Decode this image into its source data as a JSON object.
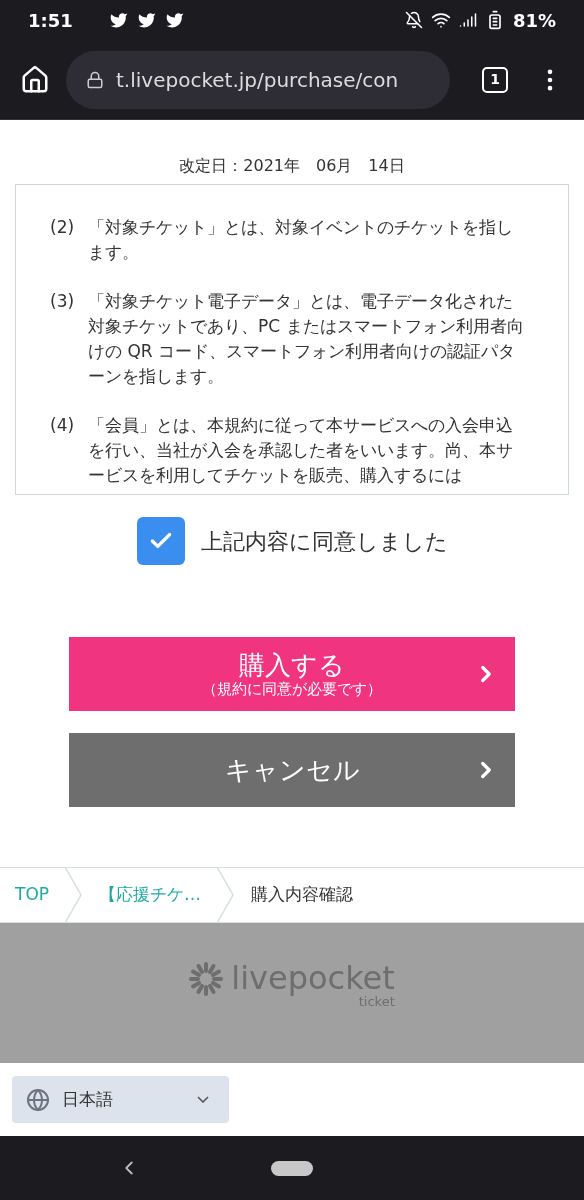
{
  "status_bar": {
    "time": "1:51",
    "battery": "81%"
  },
  "browser": {
    "url": "t.livepocket.jp/purchase/con",
    "tab_count": "1"
  },
  "revision_date": "改定日：2021年　06月　14日",
  "terms": [
    {
      "number": "(2)",
      "text": "「対象チケット」とは、対象イベントのチケットを指します。"
    },
    {
      "number": "(3)",
      "text": "「対象チケット電子データ」とは、電子データ化された対象チケットであり、PC またはスマートフォン利用者向けの QR コード、スマートフォン利用者向けの認証パターンを指します。"
    },
    {
      "number": "(4)",
      "text": "「会員」とは、本規約に従って本サービスへの入会申込を行い、当社が入会を承認した者をいいます。尚、本サービスを利用してチケットを販売、購入するには"
    }
  ],
  "agree": {
    "label": "上記内容に同意しました",
    "checked": true
  },
  "buttons": [
    {
      "kind": "primary",
      "label": "購入する",
      "sub": "（規約に同意が必要です）"
    },
    {
      "kind": "secondary",
      "label": "キャンセル"
    }
  ],
  "breadcrumb": [
    {
      "label": "TOP",
      "link": true
    },
    {
      "label": "【応援チケ…",
      "link": true
    },
    {
      "label": "購入内容確認",
      "link": false
    }
  ],
  "footer_logo": {
    "name": "livepocket",
    "sub": "ticket"
  },
  "language": "日本語"
}
